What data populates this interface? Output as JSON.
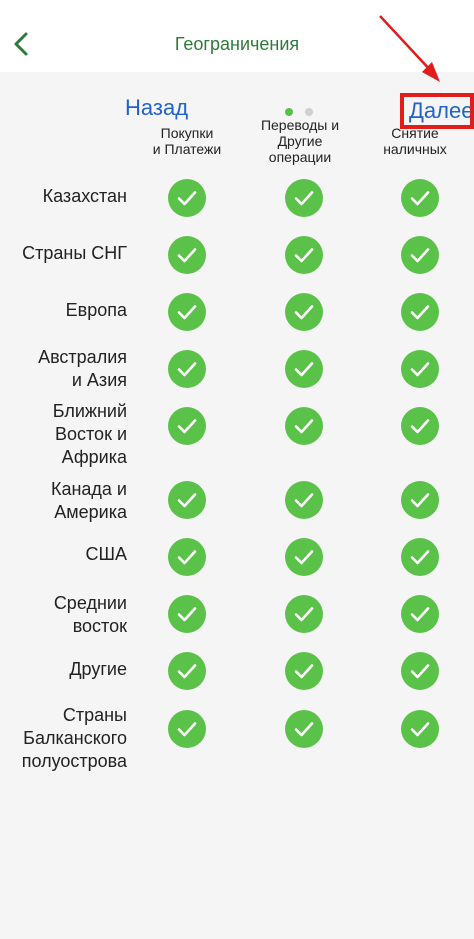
{
  "header": {
    "title": "Геограничения"
  },
  "nav": {
    "back_label": "Назад",
    "next_label": "Далее"
  },
  "columns": [
    {
      "label": "Покупки\nи Платежи"
    },
    {
      "label": "Переводы и\nДругие\nоперации"
    },
    {
      "label": "Снятие\nналичных"
    }
  ],
  "rows": [
    {
      "label": "Казахстан"
    },
    {
      "label": "Страны СНГ"
    },
    {
      "label": "Европа"
    },
    {
      "label": "Австралия\nи Азия"
    },
    {
      "label": "Ближний\nВосток и\nАфрика"
    },
    {
      "label": "Канада и\nАмерика"
    },
    {
      "label": "США"
    },
    {
      "label": "Среднии\nвосток"
    },
    {
      "label": "Другие"
    },
    {
      "label": "Страны\nБалканского\nполуострова"
    }
  ],
  "colors": {
    "accent_green": "#5bc249",
    "title_green": "#2f7a3a",
    "link_blue": "#2262c9",
    "highlight_red": "#e21b1b"
  },
  "icons": {
    "check": "check-icon",
    "back": "chevron-left-icon",
    "annotation": "red-arrow-icon"
  }
}
